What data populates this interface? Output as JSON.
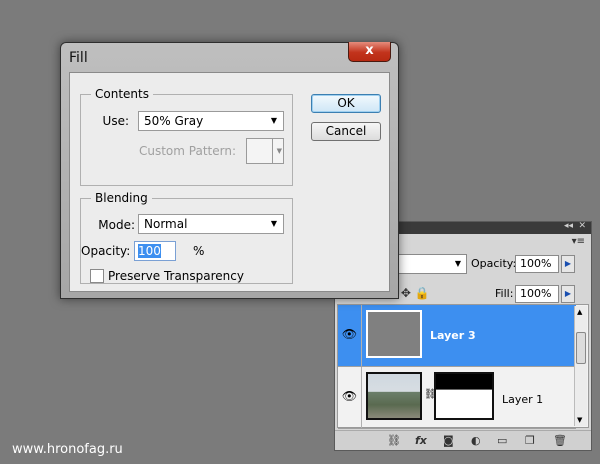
{
  "dialog": {
    "title": "Fill",
    "close_glyph": "x",
    "contents": {
      "legend": "Contents",
      "use_label": "Use:",
      "use_value": "50% Gray",
      "custom_pattern_label": "Custom Pattern:"
    },
    "blending": {
      "legend": "Blending",
      "mode_label": "Mode:",
      "mode_value": "Normal",
      "opacity_label": "Opacity:",
      "opacity_value": "100",
      "opacity_unit": "%",
      "preserve_label": "Preserve Transparency",
      "preserve_checked": false
    },
    "ok_label": "OK",
    "cancel_label": "Cancel"
  },
  "layers_panel": {
    "opacity_label": "Opacity:",
    "opacity_value": "100%",
    "fill_label": "Fill:",
    "fill_value": "100%",
    "layers": [
      {
        "name": "Layer 3",
        "selected": true,
        "visible": true
      },
      {
        "name": "Layer 1",
        "selected": false,
        "visible": true,
        "has_mask": true
      }
    ]
  },
  "colors": {
    "selection": "#3d8ff0",
    "close_button": "#c2331c",
    "canvas_gray": "#7b7b7b",
    "fill_gray": "#808080"
  },
  "watermark": "www.hronofag.ru"
}
